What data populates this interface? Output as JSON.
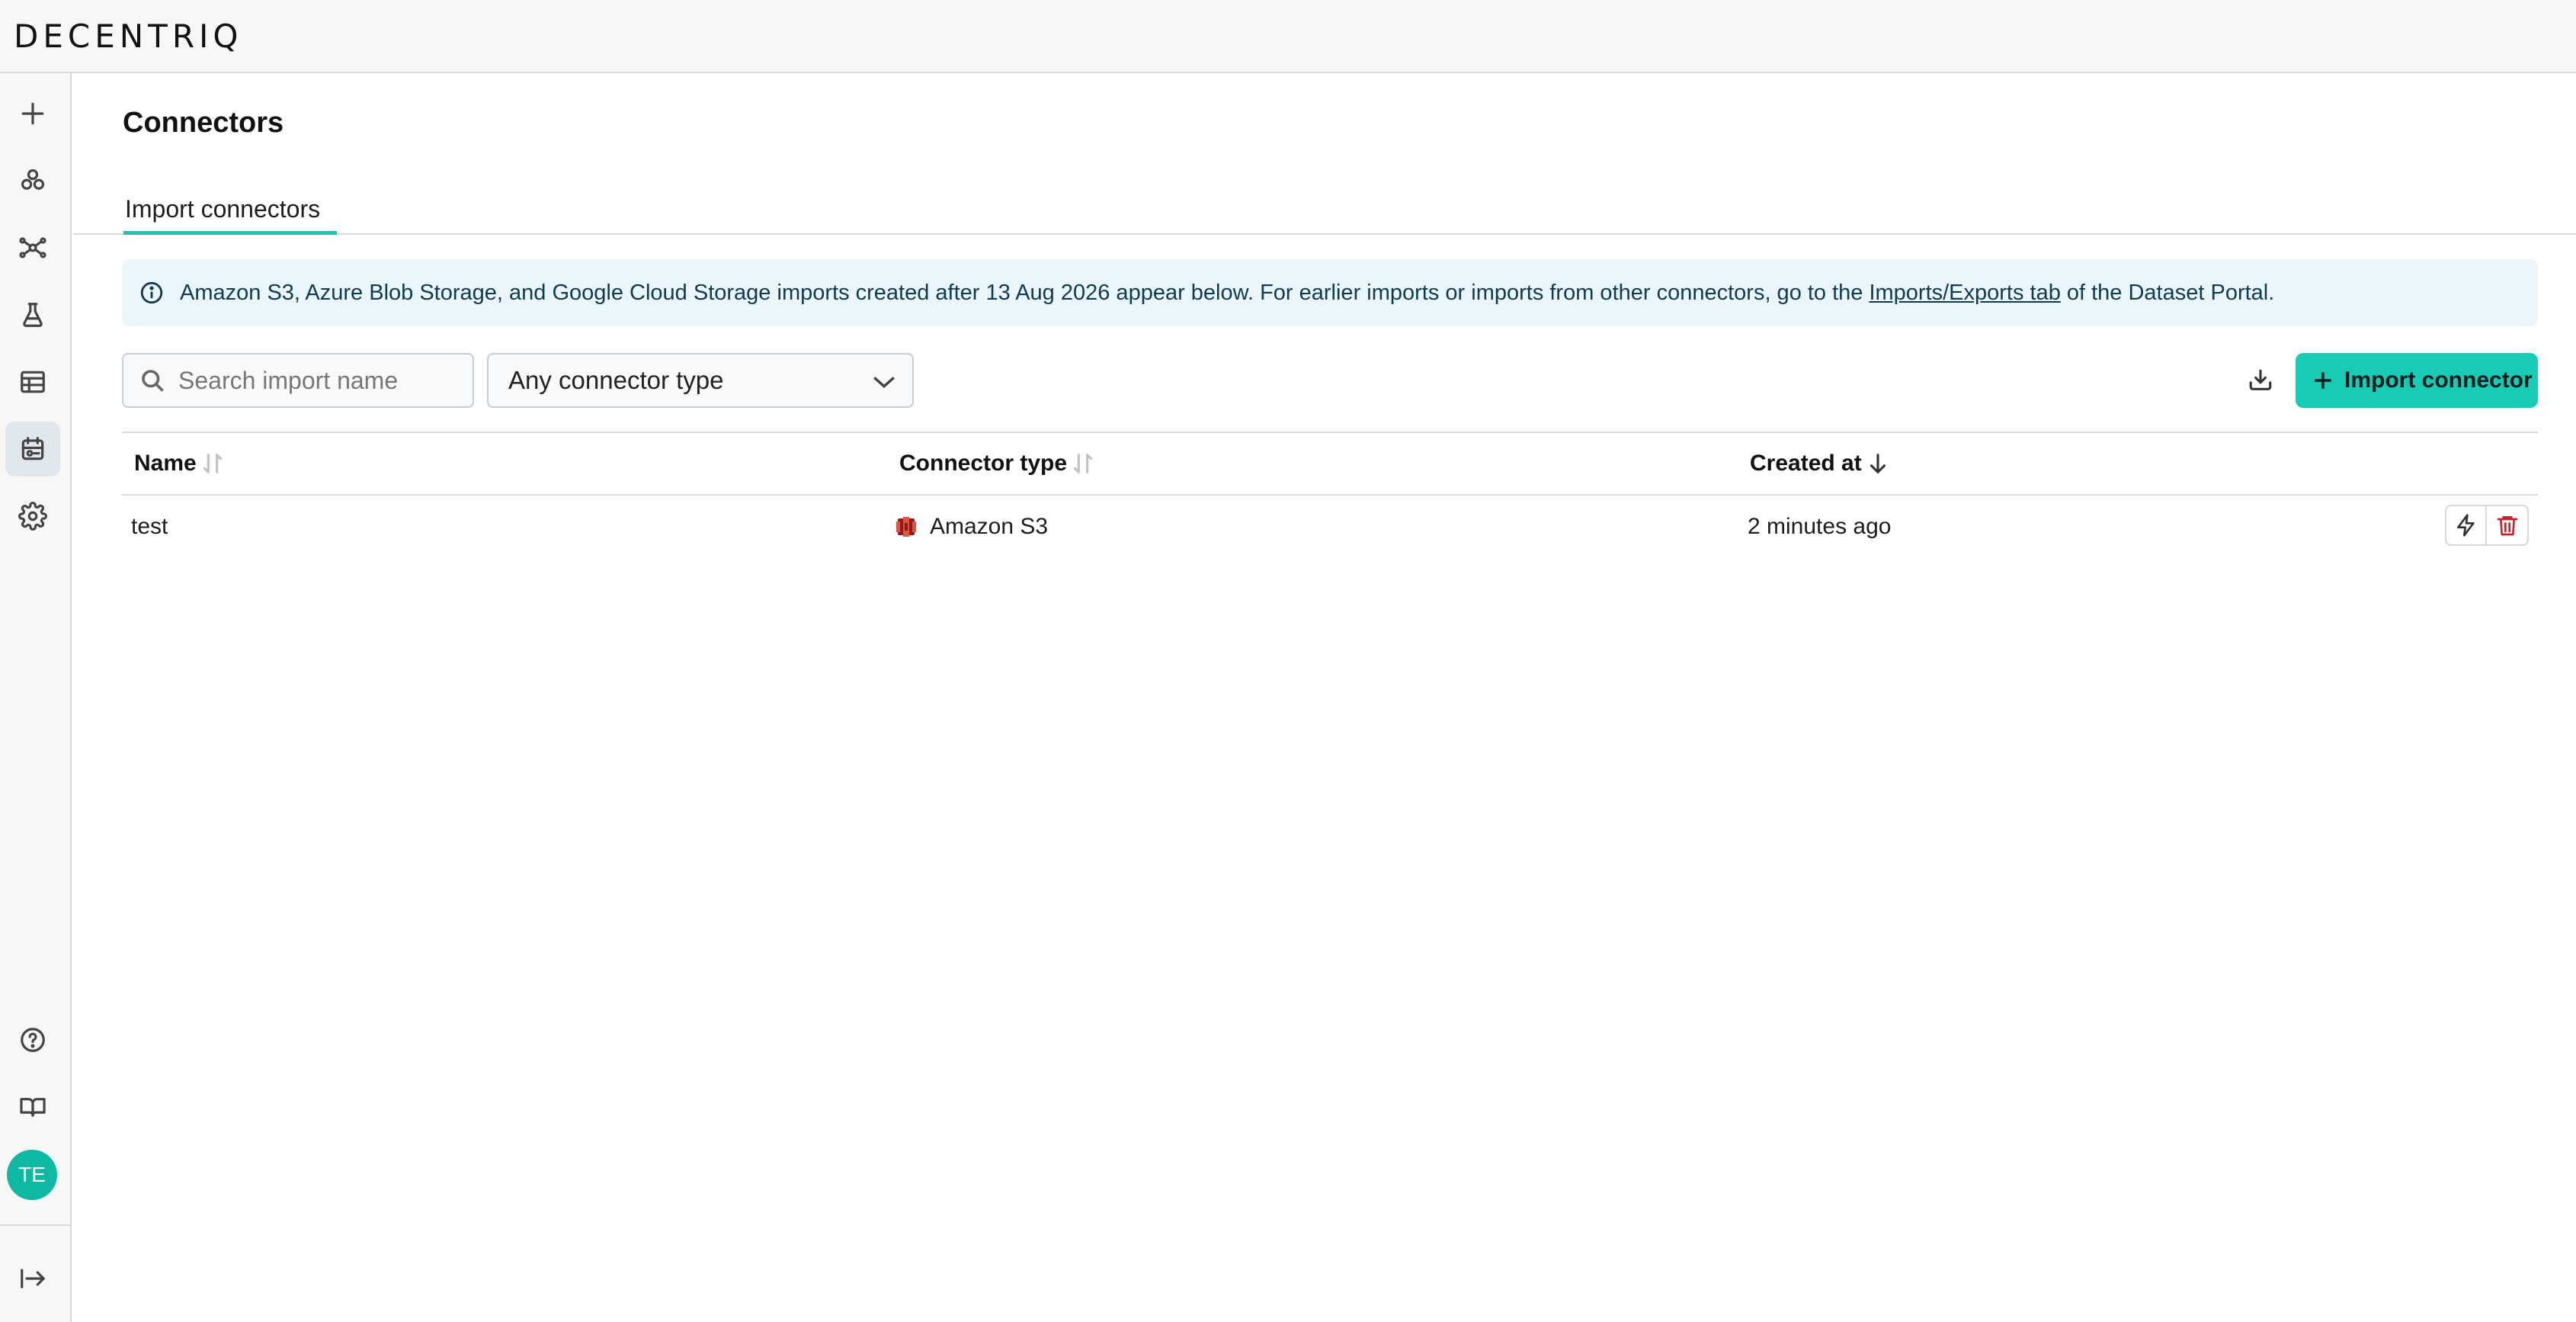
{
  "app": {
    "logo_text": "DECENTRIQ"
  },
  "sidebar": {
    "items": [
      {
        "name": "new",
        "icon": "plus-icon"
      },
      {
        "name": "data-clean-rooms",
        "icon": "cluster-icon"
      },
      {
        "name": "network",
        "icon": "network-icon"
      },
      {
        "name": "lab",
        "icon": "flask-icon"
      },
      {
        "name": "datasets",
        "icon": "table-icon"
      },
      {
        "name": "connectors",
        "icon": "connector-icon",
        "active": true
      },
      {
        "name": "settings",
        "icon": "gear-icon"
      }
    ],
    "bottom": [
      {
        "name": "help",
        "icon": "help-icon"
      },
      {
        "name": "docs",
        "icon": "book-icon"
      }
    ],
    "avatar_initials": "TE",
    "collapse_icon": "collapse-icon"
  },
  "page": {
    "title": "Connectors"
  },
  "tabs": [
    {
      "label": "Import connectors",
      "active": true
    }
  ],
  "banner": {
    "text_before": "Amazon S3, Azure Blob Storage, and Google Cloud Storage imports created after 13 Aug 2026 appear below. For earlier imports or imports from other connectors, go to the",
    "link_text": "Imports/Exports tab",
    "text_after": "of the Dataset Portal."
  },
  "toolbar": {
    "search_placeholder": "Search import name",
    "connector_type_selected": "Any connector type",
    "import_button_label": "Import connector"
  },
  "table": {
    "columns": [
      {
        "label": "Name",
        "sort": "none"
      },
      {
        "label": "Connector type",
        "sort": "none"
      },
      {
        "label": "Created at",
        "sort": "desc"
      }
    ],
    "rows": [
      {
        "name": "test",
        "connector_type": "Amazon S3",
        "created_at": "2 minutes ago"
      }
    ]
  },
  "colors": {
    "accent": "#17cbb5",
    "banner_bg": "#eaf6fb",
    "delete": "#c0262d",
    "avatar": "#0fb8a2"
  }
}
